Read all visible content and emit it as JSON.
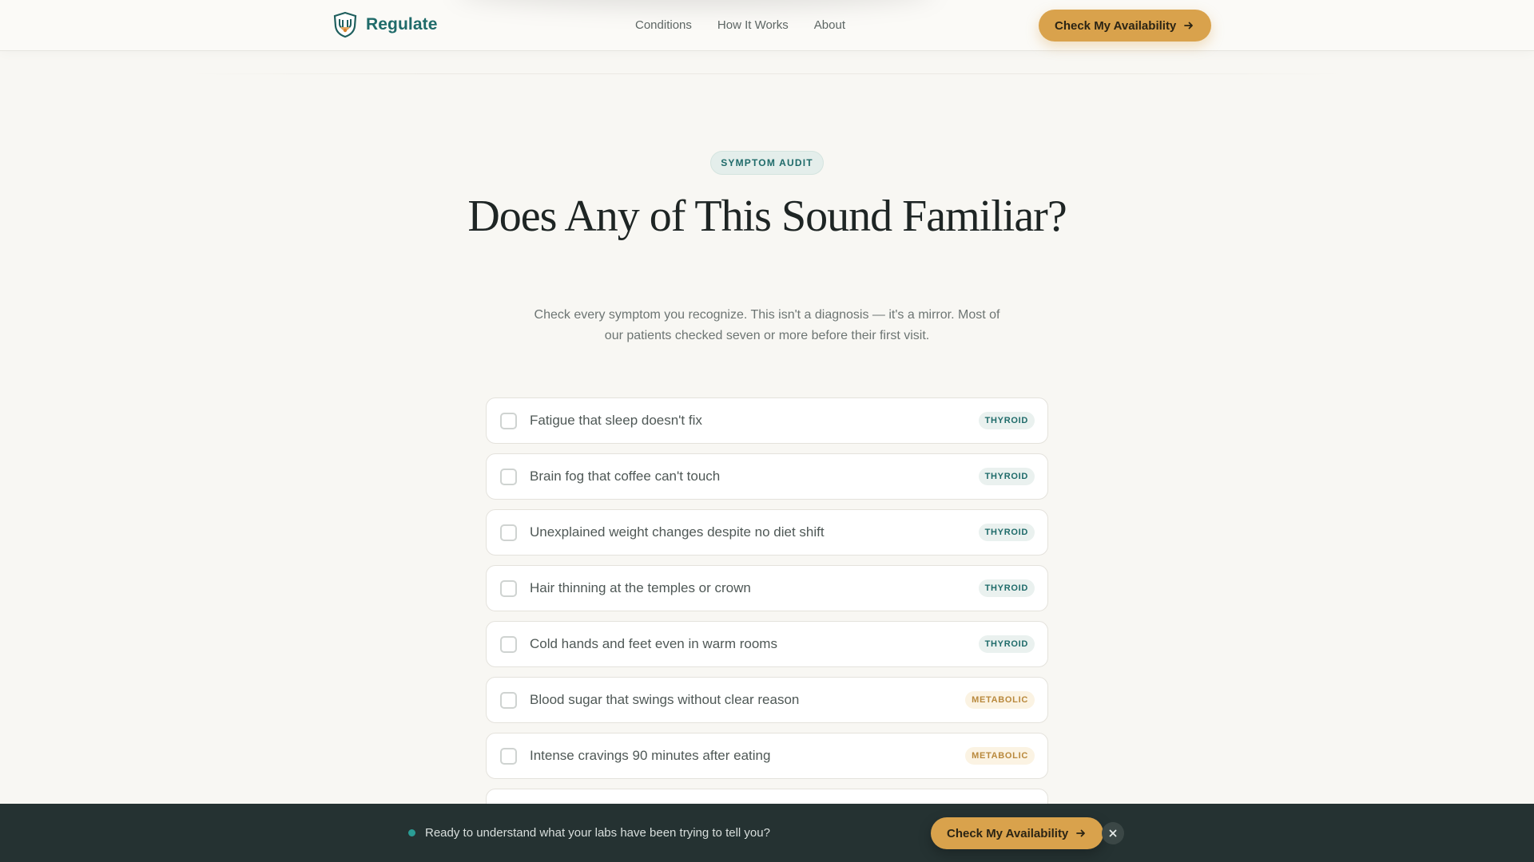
{
  "header": {
    "brand_name": "Regulate",
    "nav": [
      "Conditions",
      "How It Works",
      "About"
    ],
    "cta_label": "Check My Availability"
  },
  "hero": {
    "badge": "SYMPTOM AUDIT",
    "title": "Does Any of This Sound Familiar?",
    "subtitle": "Check every symptom you recognize. This isn't a diagnosis — it's a mirror. Most of our patients checked seven or more before their first visit."
  },
  "symptoms": [
    {
      "label": "Fatigue that sleep doesn't fix",
      "tag": "THYROID",
      "checked": false
    },
    {
      "label": "Brain fog that coffee can't touch",
      "tag": "THYROID",
      "checked": false
    },
    {
      "label": "Unexplained weight changes despite no diet shift",
      "tag": "THYROID",
      "checked": false
    },
    {
      "label": "Hair thinning at the temples or crown",
      "tag": "THYROID",
      "checked": false
    },
    {
      "label": "Cold hands and feet even in warm rooms",
      "tag": "THYROID",
      "checked": false
    },
    {
      "label": "Blood sugar that swings without clear reason",
      "tag": "METABOLIC",
      "checked": false
    },
    {
      "label": "Intense cravings 90 minutes after eating",
      "tag": "METABOLIC",
      "checked": false
    }
  ],
  "bottom_bar": {
    "message": "Ready to understand what your labs have been trying to tell you?",
    "cta_label": "Check My Availability",
    "close_icon": "close-icon"
  },
  "colors": {
    "primary": "#1f6b6a",
    "accent": "#d9a24c",
    "background": "#f8f7f3",
    "bar": "#253232"
  }
}
